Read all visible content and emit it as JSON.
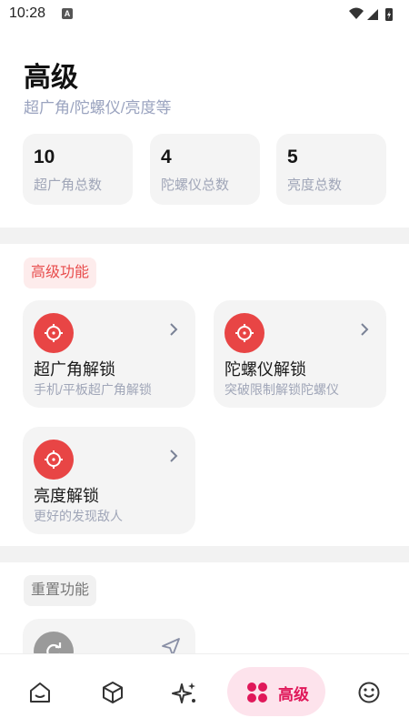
{
  "status": {
    "time": "10:28",
    "notif_glyph": "A"
  },
  "header": {
    "title": "高级",
    "subtitle": "超广角/陀螺仪/亮度等"
  },
  "stats": [
    {
      "value": "10",
      "label": "超广角总数"
    },
    {
      "value": "4",
      "label": "陀螺仪总数"
    },
    {
      "value": "5",
      "label": "亮度总数"
    }
  ],
  "sections": {
    "advanced": {
      "label": "高级功能"
    },
    "reset": {
      "label": "重置功能"
    }
  },
  "features": [
    {
      "title": "超广角解锁",
      "subtitle": "手机/平板超广角解锁",
      "icon": "crosshair-icon"
    },
    {
      "title": "陀螺仪解锁",
      "subtitle": "突破限制解锁陀螺仪",
      "icon": "crosshair-icon"
    },
    {
      "title": "亮度解锁",
      "subtitle": "更好的发现敌人",
      "icon": "crosshair-icon"
    }
  ],
  "reset_card": {
    "icon": "refresh-icon",
    "action_icon": "send-icon"
  },
  "nav": {
    "items": [
      "home-icon",
      "cube-icon",
      "sparkle-icon",
      "grid-icon",
      "smile-icon"
    ],
    "active_label": "高级"
  },
  "colors": {
    "accent": "#e84545",
    "nav_active_bg": "#fde3ec",
    "nav_active_fg": "#e0185a",
    "muted": "#9aa3bf"
  }
}
